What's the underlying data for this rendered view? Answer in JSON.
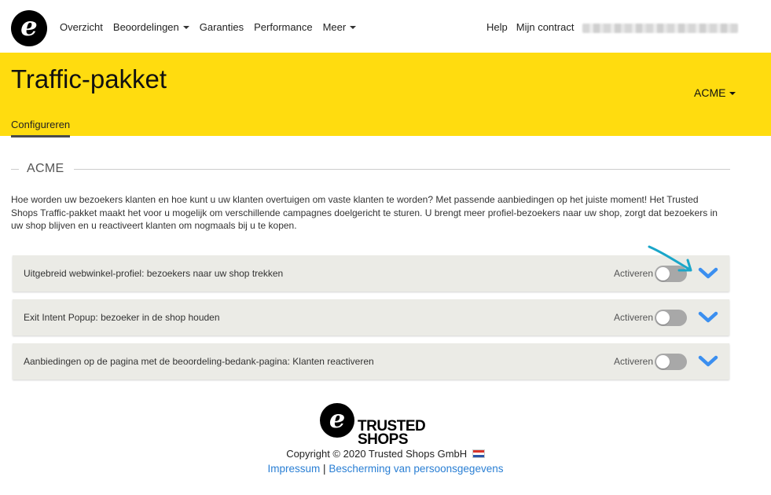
{
  "nav": {
    "logo_letter": "e",
    "items": [
      {
        "label": "Overzicht",
        "dropdown": false
      },
      {
        "label": "Beoordelingen",
        "dropdown": true
      },
      {
        "label": "Garanties",
        "dropdown": false
      },
      {
        "label": "Performance",
        "dropdown": false
      },
      {
        "label": "Meer",
        "dropdown": true
      }
    ],
    "help": "Help",
    "contract": "Mijn contract"
  },
  "hero": {
    "title": "Traffic-pakket",
    "account": "ACME",
    "tab": "Configureren",
    "background": "#ffdc0f"
  },
  "section": {
    "title": "ACME",
    "intro": "Hoe worden uw bezoekers klanten en hoe kunt u uw klanten overtuigen om vaste klanten te worden? Met passende aanbiedingen op het juiste moment! Het Trusted Shops Traffic-pakket maakt het voor u mogelijk om verschillende campagnes doelgericht te sturen. U brengt meer profiel-bezoekers naar uw shop, zorgt dat bezoekers in uw shop blijven en u reactiveert klanten om nogmaals bij u te kopen."
  },
  "panels": [
    {
      "title": "Uitgebreid webwinkel-profiel: bezoekers naar uw shop trekken",
      "activate_label": "Activeren",
      "active": false
    },
    {
      "title": "Exit Intent Popup: bezoeker in de shop houden",
      "activate_label": "Activeren",
      "active": false
    },
    {
      "title": "Aanbiedingen op de pagina met de beoordeling-bedank-pagina: Klanten reactiveren",
      "activate_label": "Activeren",
      "active": false
    }
  ],
  "footer": {
    "brand_line1": "TRUSTED",
    "brand_line2": "SHOPS",
    "copyright": "Copyright © 2020 Trusted Shops GmbH",
    "impressum": "Impressum",
    "separator": "|",
    "privacy": "Bescherming van persoonsgegevens"
  },
  "colors": {
    "accent_blue": "#3b8ff0",
    "annotation": "#1aa6c9",
    "toggle_off": "#a8a8a8"
  }
}
